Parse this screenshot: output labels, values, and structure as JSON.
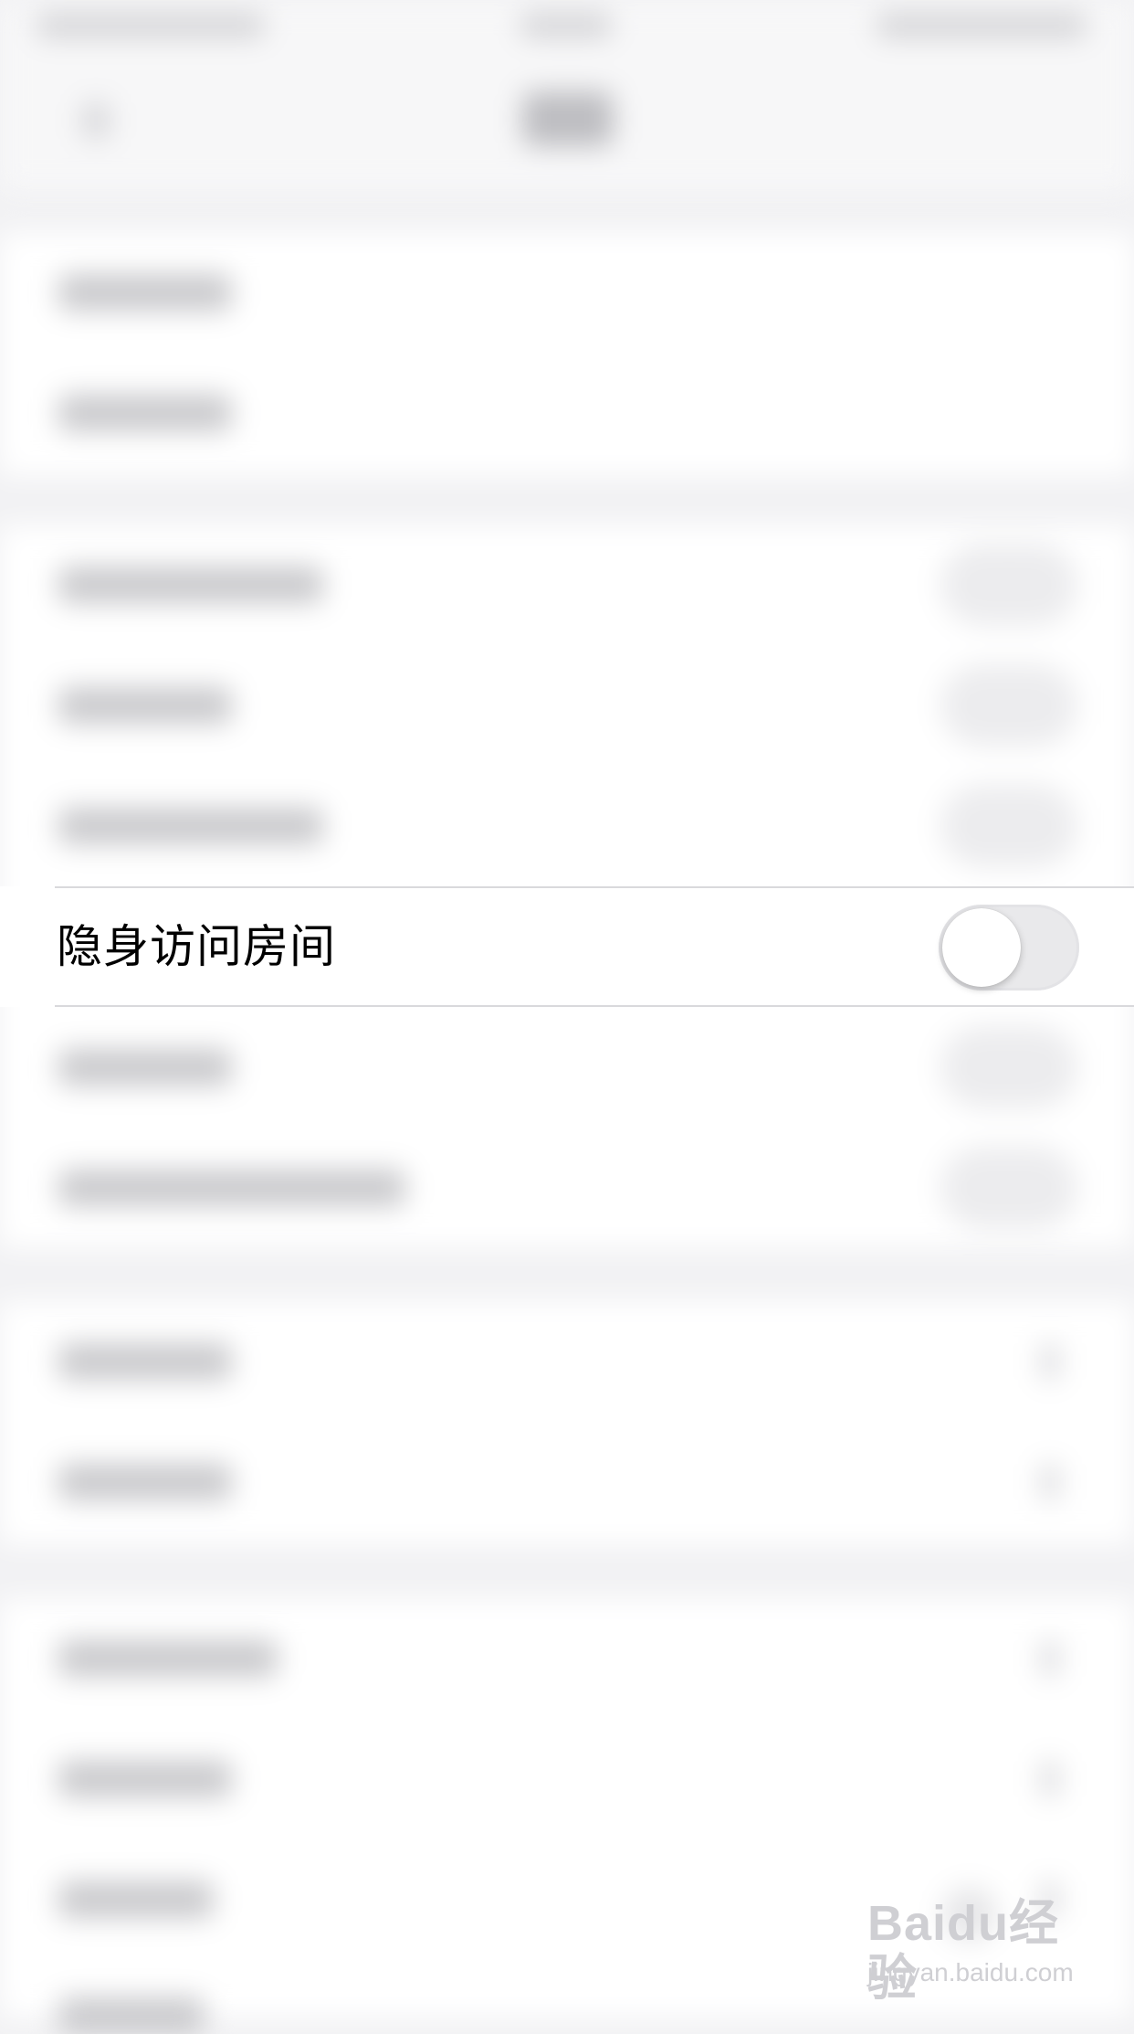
{
  "privacy_row": {
    "label": "隐身访问房间",
    "toggle_on": false
  },
  "watermark": {
    "brand": "Baidu经验",
    "domain": "jingyan.baidu.com"
  },
  "colors": {
    "page_background": "#f2f2f4",
    "row_background": "#ffffff",
    "toggle_off_track": "#e9e9eb",
    "label_text": "#000000"
  }
}
